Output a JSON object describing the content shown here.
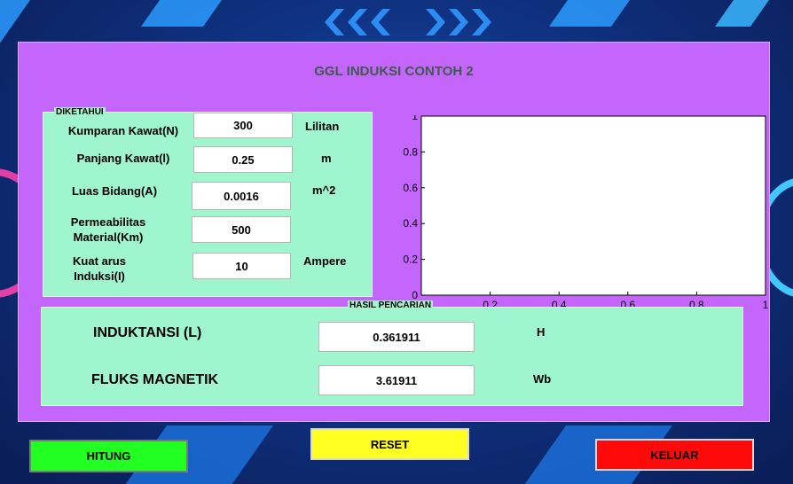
{
  "window": {
    "title": "GGL INDUKSI CONTOH 2"
  },
  "diketahui": {
    "label": "DIKETAHUI",
    "rows": [
      {
        "label": "Kumparan Kawat(N)",
        "value": "300",
        "unit": "Lilitan"
      },
      {
        "label": "Panjang Kawat(l)",
        "value": "0.25",
        "unit": "m"
      },
      {
        "label": "Luas Bidang(A)",
        "value": "0.0016",
        "unit": "m^2"
      },
      {
        "label": "Permeabilitas Material(Km)",
        "value": "500",
        "unit": ""
      },
      {
        "label": "Kuat arus Induksi(I)",
        "value": "10",
        "unit": "Ampere"
      }
    ]
  },
  "chart_data": {
    "type": "line",
    "series": [],
    "title": "",
    "xlabel": "",
    "ylabel": "",
    "xlim": [
      0,
      1
    ],
    "ylim": [
      0,
      1
    ],
    "xticks": [
      "0",
      "0.2",
      "0.4",
      "0.6",
      "0.8",
      "1"
    ],
    "yticks": [
      "0",
      "0.2",
      "0.4",
      "0.6",
      "0.8",
      "1"
    ],
    "grid": false
  },
  "hasil": {
    "label": "HASIL PENCARIAN",
    "rows": [
      {
        "label": "INDUKTANSI (L)",
        "value": "0.361911",
        "unit": "H"
      },
      {
        "label": "FLUKS MAGNETIK",
        "value": "3.61911",
        "unit": "Wb"
      }
    ]
  },
  "buttons": {
    "hitung": {
      "label": "HITUNG",
      "color": "#22ff22"
    },
    "reset": {
      "label": "RESET",
      "color": "#ffff22"
    },
    "keluar": {
      "label": "KELUAR",
      "color": "#ff0a0a"
    }
  }
}
